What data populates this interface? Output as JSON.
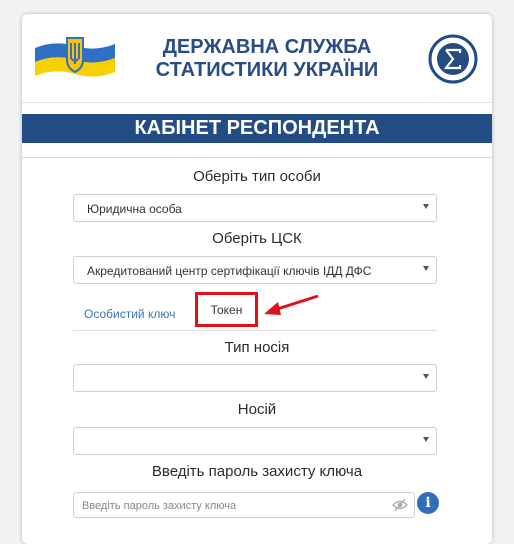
{
  "header": {
    "title_line1": "ДЕРЖАВНА СЛУЖБА",
    "title_line2": "СТАТИСТИКИ УКРАЇНИ"
  },
  "banner": {
    "title": "КАБІНЕТ РЕСПОНДЕНТА"
  },
  "form": {
    "person_type": {
      "label": "Оберіть тип особи",
      "value": "Юридична особа"
    },
    "csk": {
      "label": "Оберіть ЦСК",
      "value": "Акредитований центр сертифікації ключів ІДД ДФС"
    },
    "tabs": {
      "personal_key": "Особистий ключ",
      "token": "Токен",
      "active": "token"
    },
    "media_type": {
      "label": "Тип носія",
      "value": ""
    },
    "media": {
      "label": "Носій",
      "value": ""
    },
    "password": {
      "label": "Введіть пароль захисту ключа",
      "placeholder": "Введіть пароль захисту ключа",
      "value": ""
    }
  },
  "annotation": {
    "highlight_color": "#e0101a"
  },
  "colors": {
    "brand": "#234b84",
    "link": "#3a74b4",
    "info": "#2f6fba"
  },
  "icons": [
    "ukraine-flag-icon",
    "sigma-emblem-icon",
    "eye-slash-icon",
    "info-icon",
    "chevron-down-icon"
  ]
}
